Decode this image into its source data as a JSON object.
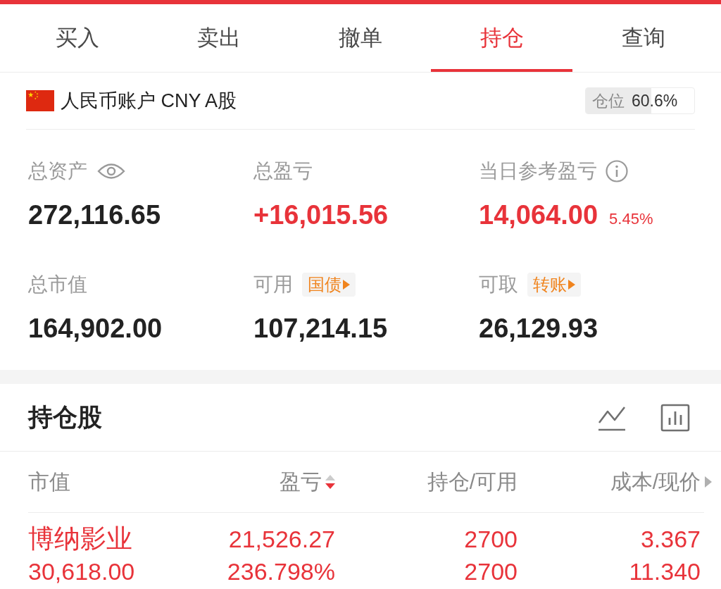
{
  "tabs": [
    {
      "label": "买入",
      "selected": false
    },
    {
      "label": "卖出",
      "selected": false
    },
    {
      "label": "撤单",
      "selected": false
    },
    {
      "label": "持仓",
      "selected": true
    },
    {
      "label": "查询",
      "selected": false
    }
  ],
  "account": {
    "name": "人民币账户 CNY A股",
    "position": {
      "label": "仓位",
      "value": "60.6%",
      "level": 0.606
    }
  },
  "stats": [
    {
      "kind": "hideable",
      "label": "总资产",
      "value": "272,116.65",
      "up": false
    },
    {
      "kind": "plain",
      "label": "总盈亏",
      "value": "+16,015.56",
      "up": true
    },
    {
      "kind": "info",
      "label": "当日参考盈亏",
      "value": "14,064.00",
      "percent": "5.45%",
      "up": true
    },
    {
      "kind": "plain",
      "label": "总市值",
      "value": "164,902.00",
      "up": false
    },
    {
      "kind": "action",
      "label": "可用",
      "action": "国债",
      "value": "107,214.15",
      "up": false
    },
    {
      "kind": "action",
      "label": "可取",
      "action": "转账",
      "value": "26,129.93",
      "up": false
    }
  ],
  "holdings": {
    "title": "持仓股",
    "columns": [
      {
        "label": "市值"
      },
      {
        "label": "盈亏",
        "sorted": true,
        "descending": true
      },
      {
        "label": "持仓/可用"
      },
      {
        "label": "成本/现价",
        "more": true
      }
    ],
    "rows": [
      {
        "name": "博纳影业",
        "market_value": "30,618.00",
        "profit": "21,526.27",
        "profit_ratio": "236.798%",
        "holding": "2700",
        "available": "2700",
        "cost": "3.367",
        "price": "11.340",
        "up": true
      }
    ]
  }
}
